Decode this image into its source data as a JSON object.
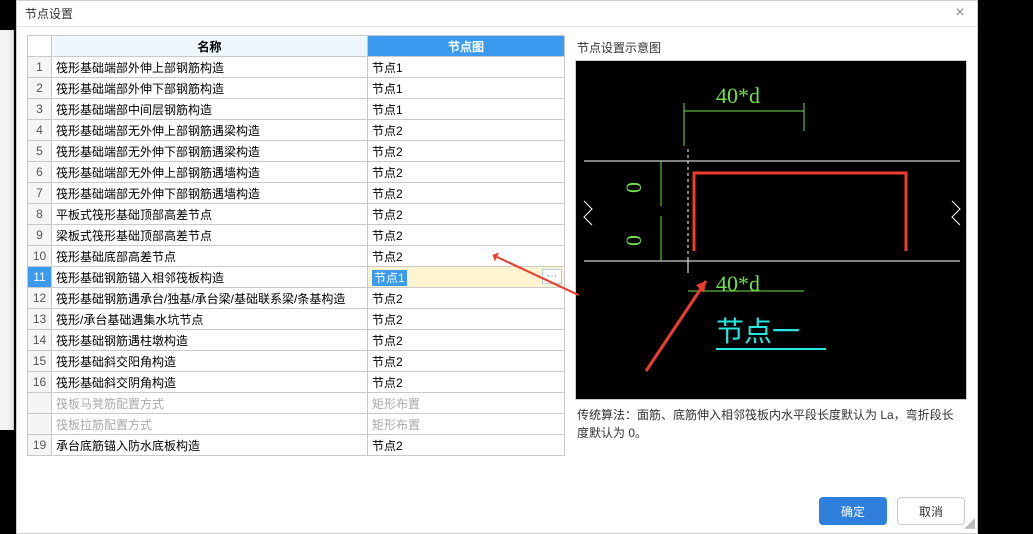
{
  "dialog": {
    "title": "节点设置",
    "close": "×"
  },
  "headers": {
    "num": "",
    "name": "名称",
    "node": "节点图"
  },
  "rows": [
    {
      "idx": "1",
      "name": "筏形基础端部外伸上部钢筋构造",
      "node": "节点1"
    },
    {
      "idx": "2",
      "name": "筏形基础端部外伸下部钢筋构造",
      "node": "节点1"
    },
    {
      "idx": "3",
      "name": "筏形基础端部中间层钢筋构造",
      "node": "节点1"
    },
    {
      "idx": "4",
      "name": "筏形基础端部无外伸上部钢筋遇梁构造",
      "node": "节点2"
    },
    {
      "idx": "5",
      "name": "筏形基础端部无外伸下部钢筋遇梁构造",
      "node": "节点2"
    },
    {
      "idx": "6",
      "name": "筏形基础端部无外伸上部钢筋遇墙构造",
      "node": "节点2"
    },
    {
      "idx": "7",
      "name": "筏形基础端部无外伸下部钢筋遇墙构造",
      "node": "节点2"
    },
    {
      "idx": "8",
      "name": "平板式筏形基础顶部高差节点",
      "node": "节点2"
    },
    {
      "idx": "9",
      "name": "梁板式筏形基础顶部高差节点",
      "node": "节点2"
    },
    {
      "idx": "10",
      "name": "筏形基础底部高差节点",
      "node": "节点2"
    },
    {
      "idx": "11",
      "name": "筏形基础钢筋锚入相邻筏板构造",
      "node": "节点1",
      "selected": true
    },
    {
      "idx": "12",
      "name": "筏形基础钢筋遇承台/独基/承台梁/基础联系梁/条基构造",
      "node": "节点2"
    },
    {
      "idx": "13",
      "name": "筏形/承台基础遇集水坑节点",
      "node": "节点2"
    },
    {
      "idx": "14",
      "name": "筏形基础钢筋遇柱墩构造",
      "node": "节点2"
    },
    {
      "idx": "15",
      "name": "筏形基础斜交阳角构造",
      "node": "节点2"
    },
    {
      "idx": "16",
      "name": "筏形基础斜交阴角构造",
      "node": "节点2"
    },
    {
      "idx": "",
      "name": "筏板马凳筋配置方式",
      "node": "矩形布置",
      "grey": true
    },
    {
      "idx": "",
      "name": "筏板拉筋配置方式",
      "node": "矩形布置",
      "grey": true
    },
    {
      "idx": "19",
      "name": "承台底筋锚入防水底板构造",
      "node": "节点2"
    }
  ],
  "preview": {
    "title": "节点设置示意图",
    "label_top": "40*d",
    "label_bottom": "40*d",
    "label_node": "节点一",
    "zero1": "0",
    "zero2": "0"
  },
  "explain": "传统算法：面筋、底筋伸入相邻筏板内水平段长度默认为 La，弯折段长度默认为 0。",
  "buttons": {
    "ok": "确定",
    "cancel": "取消"
  },
  "more": "⋯"
}
